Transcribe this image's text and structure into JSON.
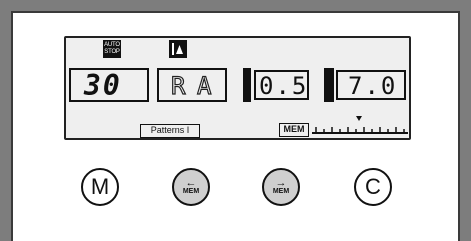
{
  "lcd": {
    "auto_stop_label": "AUTO\nSTOP",
    "counter_value": "30",
    "pattern_glyph_1": "R",
    "pattern_glyph_2": "A",
    "width_value": "0.5",
    "length_value": "7.0",
    "patterns_label": "Patterns I",
    "mem_label": "MEM"
  },
  "buttons": {
    "m_label": "M",
    "mem_back_label": "MEM",
    "mem_forward_label": "MEM",
    "c_label": "C"
  },
  "icons": {
    "auto_stop": "auto-stop-icon",
    "needle_position": "needle-position-icon",
    "left_arrow": "left-arrow-icon",
    "right_arrow": "right-arrow-icon"
  }
}
